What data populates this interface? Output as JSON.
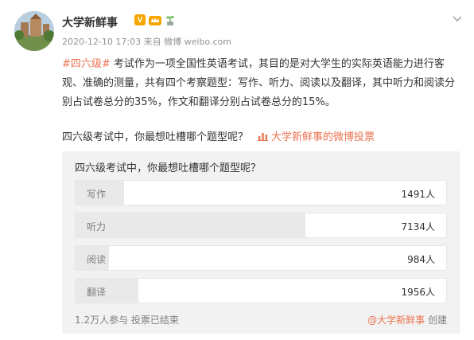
{
  "user": {
    "name": "大学新鲜事"
  },
  "badges": {
    "verified": "V"
  },
  "meta": {
    "timestamp": "2020-12-10 17:03",
    "source_prefix": "来自",
    "source": "微博 weibo.com"
  },
  "post": {
    "hashtag": "#四六级#",
    "body": " 考试作为一项全国性英语考试，其目的是对大学生的实际英语能力进行客观、准确的测量，共有四个考察题型：写作、听力、阅读以及翻译，其中听力和阅读分别占试卷总分的35%，作文和翻译分别占试卷总分的15%。"
  },
  "vote_prompt": {
    "question": "四六级考试中，你最想吐槽哪个题型呢？",
    "link_label": "大学新鲜事的微博投票"
  },
  "poll": {
    "title": "四六级考试中，你最想吐槽哪个题型呢？",
    "options": [
      {
        "label": "写作",
        "count": "1491人",
        "share": 0.13
      },
      {
        "label": "听力",
        "count": "7134人",
        "share": 0.62
      },
      {
        "label": "阅读",
        "count": "984人",
        "share": 0.09
      },
      {
        "label": "翻译",
        "count": "1956人",
        "share": 0.17
      }
    ],
    "participants": "1.2万人参与",
    "status": "投票已结束",
    "creator": "@大学新鲜事",
    "creator_suffix": "创建"
  },
  "colors": {
    "accent": "#eb7350",
    "badge_gold": "#f7a600"
  },
  "icons": {
    "chevron": "chevron-down-icon",
    "vote": "vote-icon"
  }
}
